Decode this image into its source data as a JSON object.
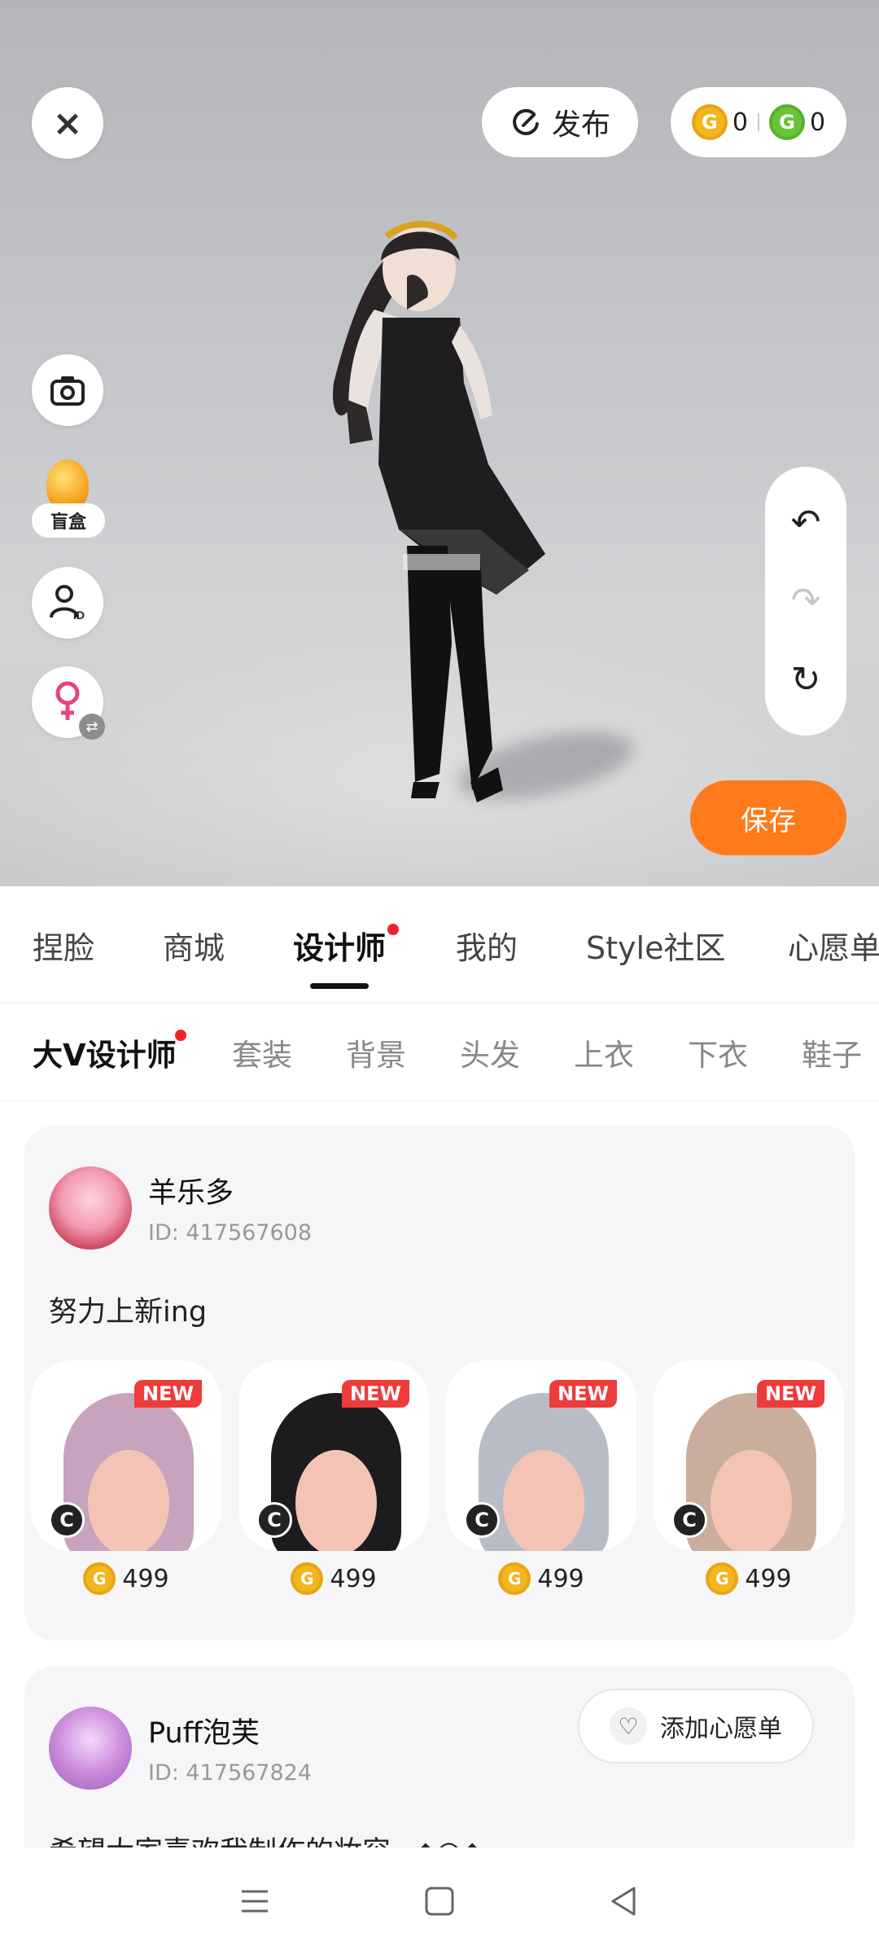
{
  "stage": {
    "close_icon": "×",
    "publish_label": "发布",
    "coins": {
      "gold_value": "0",
      "green_value": "0",
      "gold_icon": "G",
      "green_icon": "G"
    },
    "blind_box_label": "盲盒",
    "save_label": "保存"
  },
  "main_tabs": [
    {
      "label": "捏脸"
    },
    {
      "label": "商城"
    },
    {
      "label": "设计师"
    },
    {
      "label": "我的"
    },
    {
      "label": "Style社区"
    },
    {
      "label": "心愿单"
    }
  ],
  "sub_tabs": [
    {
      "label": "大V设计师"
    },
    {
      "label": "套装"
    },
    {
      "label": "背景"
    },
    {
      "label": "头发"
    },
    {
      "label": "上衣"
    },
    {
      "label": "下衣"
    },
    {
      "label": "鞋子"
    }
  ],
  "designers": [
    {
      "name": "羊乐多",
      "id": "ID: 417567608",
      "desc": "努力上新ing",
      "items": [
        {
          "badge": "NEW",
          "price": "499",
          "c": "C",
          "hair_color": "#c7a3bd"
        },
        {
          "badge": "NEW",
          "price": "499",
          "c": "C",
          "hair_color": "#1c1c1e"
        },
        {
          "badge": "NEW",
          "price": "499",
          "c": "C",
          "hair_color": "#b9bcc7"
        },
        {
          "badge": "NEW",
          "price": "499",
          "c": "C",
          "hair_color": "#c9ae9e"
        }
      ]
    },
    {
      "name": "Puff泡芙",
      "id": "ID: 417567824",
      "wishlist_label": "添加心愿单",
      "desc_partial": "希望大家喜欢我制作的妆容~◆○◆"
    }
  ],
  "colors": {
    "accent": "#ff7a1a",
    "badge_red": "#ee3b3b",
    "coin_gold": "#f3b61f",
    "coin_green": "#68c53a"
  }
}
